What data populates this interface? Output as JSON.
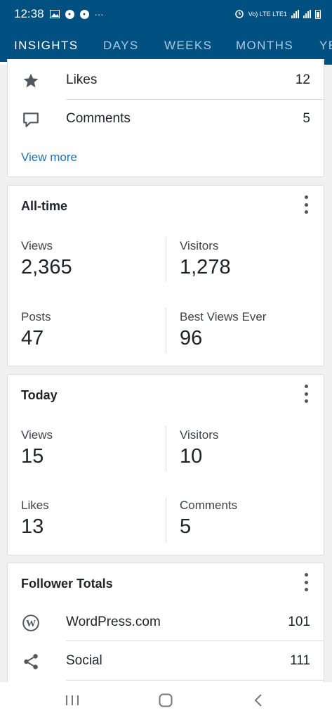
{
  "status_bar": {
    "time": "12:38",
    "network_label": "Vo) LTE LTE1"
  },
  "tabs": [
    {
      "label": "INSIGHTS",
      "active": true
    },
    {
      "label": "DAYS",
      "active": false
    },
    {
      "label": "WEEKS",
      "active": false
    },
    {
      "label": "MONTHS",
      "active": false
    },
    {
      "label": "YEARS",
      "active": false
    }
  ],
  "summary_card": {
    "rows": [
      {
        "label": "Likes",
        "value": "12",
        "icon": "star-icon"
      },
      {
        "label": "Comments",
        "value": "5",
        "icon": "comment-icon"
      }
    ],
    "view_more": "View more"
  },
  "all_time": {
    "title": "All-time",
    "stats": [
      {
        "label": "Views",
        "value": "2,365"
      },
      {
        "label": "Visitors",
        "value": "1,278"
      },
      {
        "label": "Posts",
        "value": "47"
      },
      {
        "label": "Best Views Ever",
        "value": "96"
      }
    ]
  },
  "today": {
    "title": "Today",
    "stats": [
      {
        "label": "Views",
        "value": "15"
      },
      {
        "label": "Visitors",
        "value": "10"
      },
      {
        "label": "Likes",
        "value": "13"
      },
      {
        "label": "Comments",
        "value": "5"
      }
    ]
  },
  "followers": {
    "title": "Follower Totals",
    "rows": [
      {
        "label": "WordPress.com",
        "value": "101",
        "icon": "wordpress-icon"
      },
      {
        "label": "Social",
        "value": "111",
        "icon": "share-icon"
      }
    ]
  },
  "colors": {
    "header": "#005082",
    "link": "#2271b1"
  }
}
